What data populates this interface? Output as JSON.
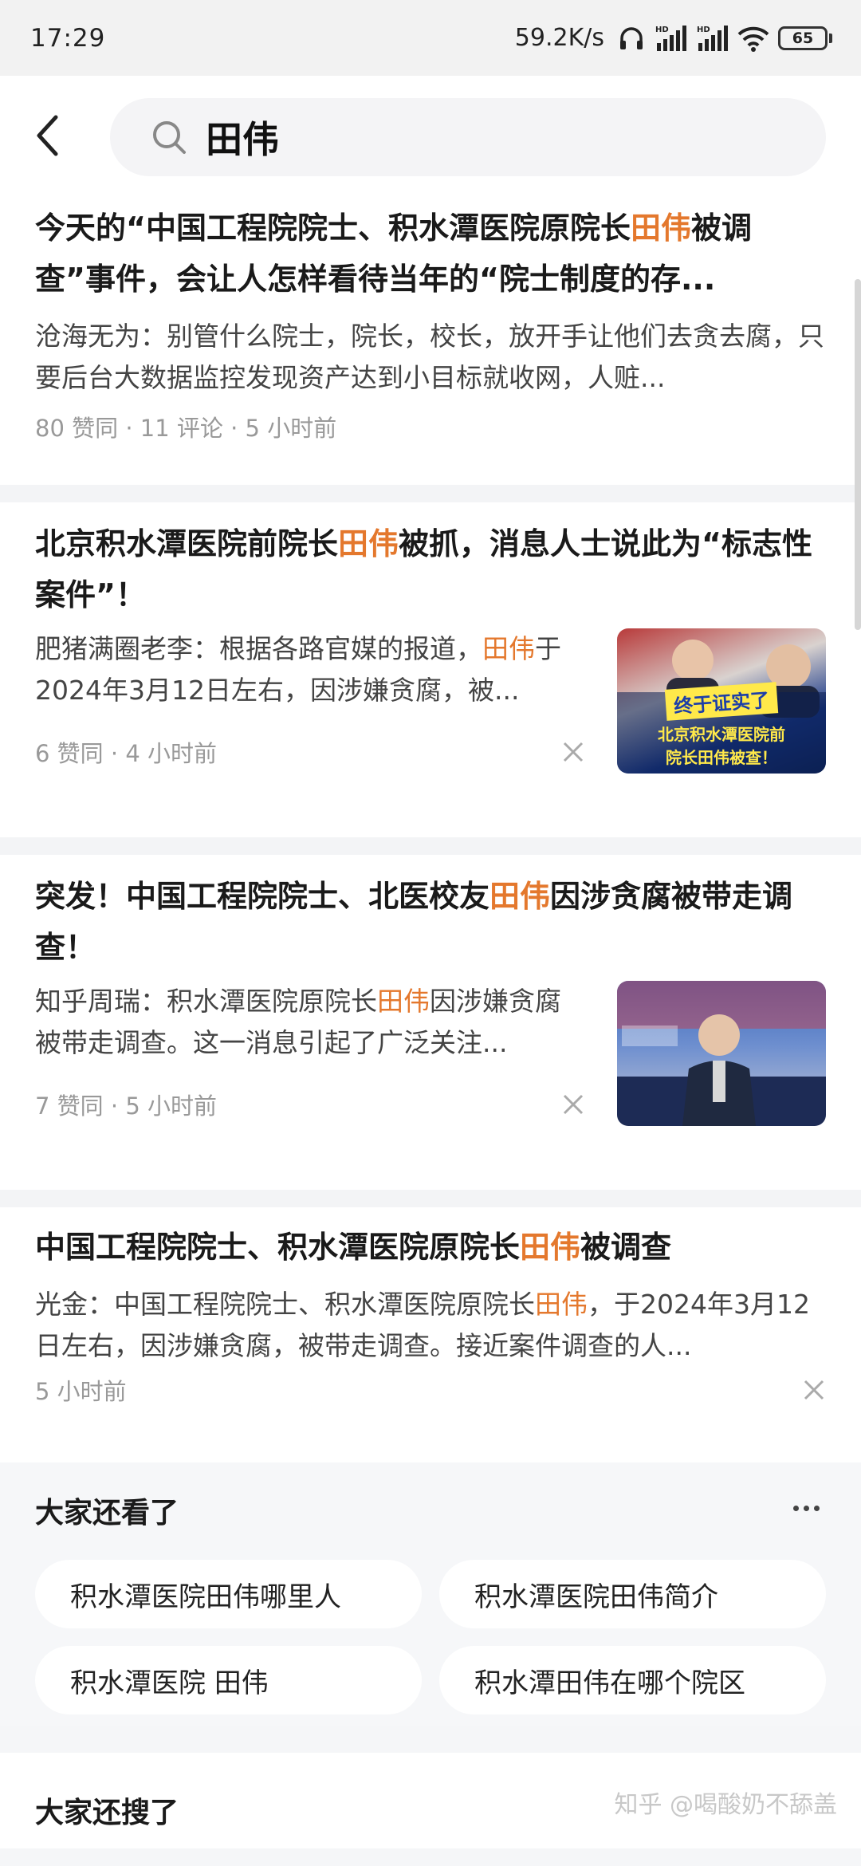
{
  "status_bar": {
    "time": "17:29",
    "net_speed": "59.2K/s",
    "battery": "65",
    "icons": [
      "headphones-icon",
      "signal-hd-icon",
      "signal-hd-icon",
      "wifi-icon",
      "battery-icon"
    ]
  },
  "search": {
    "query": "田伟",
    "back_icon": "back-arrow-icon",
    "search_icon": "search-icon"
  },
  "results": [
    {
      "title_parts": [
        "今天的“中国工程院院士、积水潭医院原院长",
        "田伟",
        "被调查”事件，会让人怎样看待当年的“院士制度的存..."
      ],
      "excerpt_parts": [
        "沧海无为：别管什么院士，院长，校长，放开手让他们去贪去腐，只要后台大数据监控发现资产达到小目标就收网，人赃..."
      ],
      "meta": "80 赞同 · 11 评论 · 5 小时前"
    },
    {
      "title_parts": [
        "北京积水潭医院前院长",
        "田伟",
        "被抓，消息人士说此为“标志性案件”！"
      ],
      "excerpt_parts": [
        "肥猪满圈老李：根据各路官媒的报道，",
        "田伟",
        "于2024年3月12日左右，因涉嫌贪腐，被..."
      ],
      "meta": "6 赞同 · 4 小时前",
      "thumb_caption_1": "终于证实了",
      "thumb_caption_2": "北京积水潭医院前",
      "thumb_caption_3": "院长田伟被查！"
    },
    {
      "title_parts": [
        "突发！中国工程院院士、北医校友",
        "田伟",
        "因涉贪腐被带走调查！"
      ],
      "excerpt_parts": [
        "知乎周瑞：积水潭医院原院长",
        "田伟",
        "因涉嫌贪腐被带走调查。这一消息引起了广泛关注..."
      ],
      "meta": "7 赞同 · 5 小时前"
    },
    {
      "title_parts": [
        "中国工程院院士、积水潭医院原院长",
        "田伟",
        "被调查"
      ],
      "excerpt_parts": [
        "光金：中国工程院院士、积水潭医院原院长",
        "田伟",
        "，于2024年3月12日左右，因涉嫌贪腐，被带走调查。接近案件调查的人..."
      ],
      "meta": "5 小时前"
    }
  ],
  "related": {
    "title": "大家还看了",
    "chips": [
      "积水潭医院田伟哪里人",
      "积水潭医院田伟简介",
      "积水潭医院 田伟",
      "积水潭田伟在哪个院区"
    ]
  },
  "searched": {
    "title": "大家还搜了",
    "watermark": "知乎 @喝酸奶不舔盖"
  },
  "colors": {
    "highlight": "#e4782d",
    "meta": "#999999",
    "background": "#f5f6f8"
  }
}
